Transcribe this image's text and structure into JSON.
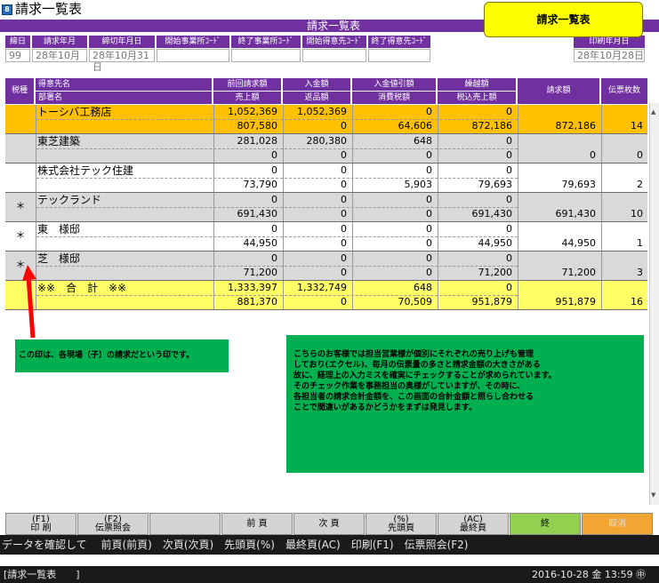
{
  "window": {
    "title": "請求一覧表",
    "banner": "請求一覧表",
    "tag": "請求一覧表"
  },
  "filters": {
    "headers": [
      "締日",
      "請求年月",
      "締切年月日",
      "開始事業所ｺｰﾄﾞ",
      "終了事業所ｺｰﾄﾞ",
      "開始得意先ｺｰﾄﾞ",
      "終了得意先ｺｰﾄﾞ",
      "印刷年月日"
    ],
    "values": [
      "99",
      "28年10月",
      "28年10月31日",
      "",
      "",
      "",
      "",
      "28年10月28日"
    ]
  },
  "table": {
    "headers": {
      "kubun": "税種",
      "customer": "得意先名",
      "dept": "部署名",
      "prev_bill": "前回請求額",
      "sales": "売上額",
      "paid": "入金額",
      "returns": "返品額",
      "pay_discount": "入金値引額",
      "tax": "消費税額",
      "carry": "繰越額",
      "taxed_sales": "税込売上額",
      "invoice": "請求額",
      "slips": "伝票枚数"
    },
    "rows": [
      {
        "mark": "",
        "name": "トーシバ工務店",
        "prev_bill": "1,052,369",
        "paid": "1,052,369",
        "pay_discount": "0",
        "carry": "0",
        "sales": "807,580",
        "returns": "0",
        "tax": "64,606",
        "taxed_sales": "872,186",
        "invoice": "872,186",
        "slips": "14"
      },
      {
        "mark": "",
        "name": "東芝建築",
        "prev_bill": "281,028",
        "paid": "280,380",
        "pay_discount": "648",
        "carry": "0",
        "sales": "0",
        "returns": "0",
        "tax": "0",
        "taxed_sales": "0",
        "invoice": "0",
        "slips": "0"
      },
      {
        "mark": "",
        "name": "株式会社テック住建",
        "prev_bill": "0",
        "paid": "0",
        "pay_discount": "0",
        "carry": "0",
        "sales": "73,790",
        "returns": "0",
        "tax": "5,903",
        "taxed_sales": "79,693",
        "invoice": "79,693",
        "slips": "2"
      },
      {
        "mark": "＊",
        "name": "テックランド",
        "prev_bill": "0",
        "paid": "0",
        "pay_discount": "0",
        "carry": "0",
        "sales": "691,430",
        "returns": "0",
        "tax": "0",
        "taxed_sales": "691,430",
        "invoice": "691,430",
        "slips": "10"
      },
      {
        "mark": "＊",
        "name": "東　様邸",
        "prev_bill": "0",
        "paid": "0",
        "pay_discount": "0",
        "carry": "0",
        "sales": "44,950",
        "returns": "0",
        "tax": "0",
        "taxed_sales": "44,950",
        "invoice": "44,950",
        "slips": "1"
      },
      {
        "mark": "＊",
        "name": "芝　様邸",
        "prev_bill": "0",
        "paid": "0",
        "pay_discount": "0",
        "carry": "0",
        "sales": "71,200",
        "returns": "0",
        "tax": "0",
        "taxed_sales": "71,200",
        "invoice": "71,200",
        "slips": "3"
      }
    ],
    "total": {
      "label": "※※　合　計　※※",
      "prev_bill": "1,333,397",
      "paid": "1,332,749",
      "pay_discount": "648",
      "carry": "0",
      "sales": "881,370",
      "returns": "0",
      "tax": "70,509",
      "taxed_sales": "951,879",
      "invoice": "951,879",
      "slips": "16"
    }
  },
  "annotations": {
    "left": "この印は、各現場（子）の請求だという印です。",
    "right": [
      "こちらのお客様では担当営業様が個別にそれぞれの売り上げも管理",
      "しており(エクセル)、毎月の伝票量の多さと請求金額の大きさがある",
      "故に、経理上の入力ミスを確実にチェックすることが求められています。",
      "そのチェック作業を事務担当の奥様がしていますが、その時に、",
      "各担当者の請求合計金額を、この画面の合計金額と照らし合わせる",
      "ことで間違いがあるかどうかをまずは発見します。"
    ]
  },
  "toolbar": {
    "f1_key": "(F1)",
    "f1_label": "印 刷",
    "f2_key": "(F2)",
    "f2_label": "伝票照会",
    "prev": "前 頁",
    "next": "次 頁",
    "first_key": "(%)",
    "first_label": "先頭頁",
    "last_key": "(AC)",
    "last_label": "最終頁",
    "end": "終",
    "cancel": "取消"
  },
  "status": {
    "help": "データを確認して　 前頁(前頁)　次頁(次頁)　先頭頁(%)　最終頁(AC)　印刷(F1)　伝票照会(F2)",
    "screen": "[請求一覧表　　]",
    "datetime": "2016-10-28 金 13:59 ㊥"
  },
  "colors": {
    "header_purple": "#7030a0",
    "row_highlight": "#ffc000",
    "row_gray": "#d9d9d9",
    "total_yellow": "#ffff66",
    "note_green": "#00b050",
    "end_button": "#92d050",
    "cancel_button": "#f2a533"
  }
}
